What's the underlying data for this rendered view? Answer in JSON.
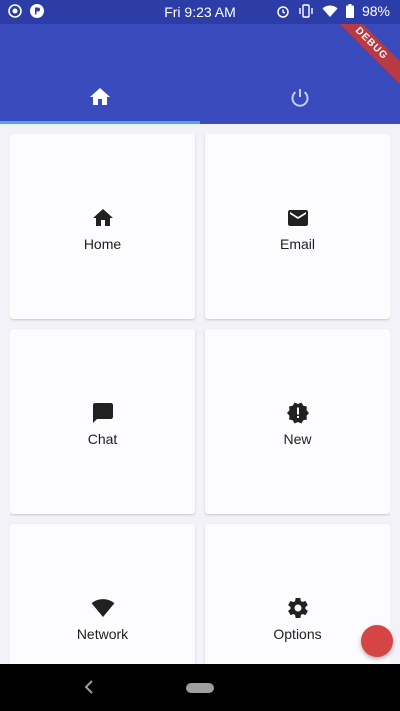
{
  "status_bar": {
    "time": "Fri 9:23 AM",
    "battery": "98%",
    "left_icons": [
      "record-icon",
      "p-icon"
    ],
    "right_icons": [
      "alarm-icon",
      "vibrate-icon",
      "wifi-icon",
      "battery-icon"
    ]
  },
  "debug_banner": "DEBUG",
  "tabs": [
    {
      "icon": "home-icon",
      "selected": true
    },
    {
      "icon": "power-icon",
      "selected": false
    }
  ],
  "cards": [
    {
      "label": "Home",
      "icon": "home-icon"
    },
    {
      "label": "Email",
      "icon": "email-icon"
    },
    {
      "label": "Chat",
      "icon": "chat-icon"
    },
    {
      "label": "New",
      "icon": "new-releases-icon"
    },
    {
      "label": "Network",
      "icon": "wifi-icon"
    },
    {
      "label": "Options",
      "icon": "settings-icon"
    }
  ],
  "colors": {
    "app_bar": "#3a4bbd",
    "status_bar": "#2c3da7",
    "tab_indicator": "#4fa3f3",
    "fab": "#d64545",
    "background": "#f3f2f8"
  }
}
